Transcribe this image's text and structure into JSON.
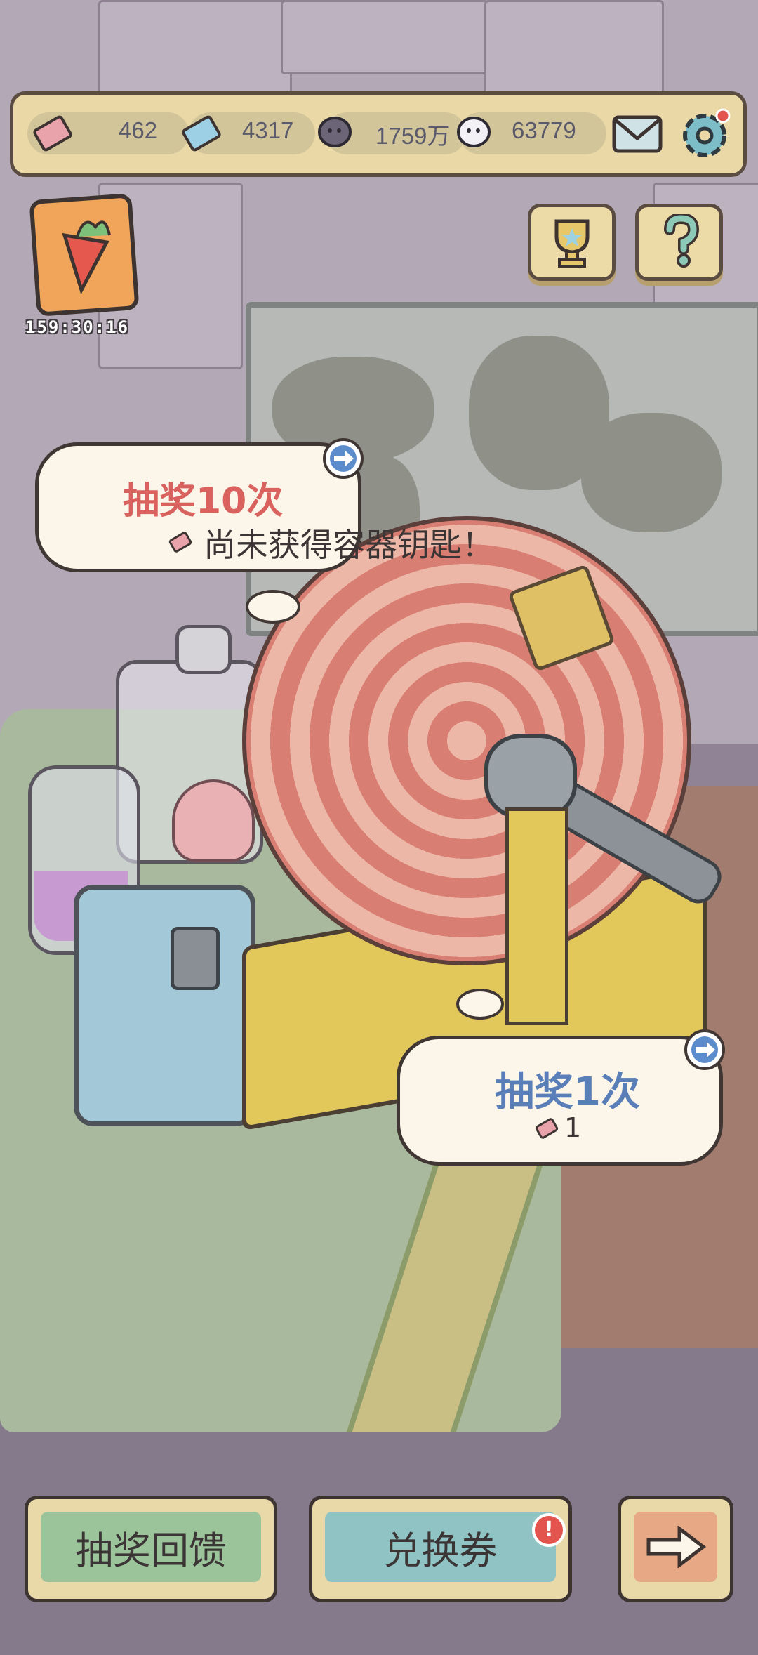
{
  "resources": [
    {
      "name": "ticket-icon",
      "value": "462"
    },
    {
      "name": "blue-ticket-icon",
      "value": "4317"
    },
    {
      "name": "dark-soul-icon",
      "value": "1759万"
    },
    {
      "name": "white-soul-icon",
      "value": "63779"
    }
  ],
  "header": {
    "mail_icon": "mail-icon",
    "settings_icon": "gear-icon",
    "settings_badge": true
  },
  "side_buttons": {
    "trophy_icon": "trophy-icon",
    "help_icon": "question-mark-icon"
  },
  "event": {
    "timer": "159:30:16"
  },
  "draw10": {
    "title": "抽奖10次",
    "status": "尚未获得容器钥匙！"
  },
  "draw1": {
    "title": "抽奖1次",
    "cost": "1"
  },
  "bottom": {
    "feedback_label": "抽奖回馈",
    "exchange_label": "兑换券",
    "next_icon": "right-arrow-icon"
  },
  "colors": {
    "bubble_title_red": "#d9625f",
    "bubble_title_blue": "#5a7fb8",
    "bar_bg": "#ead9a6",
    "exchange_btn": "#8fc3c4",
    "feedback_btn": "#9cc49b"
  }
}
